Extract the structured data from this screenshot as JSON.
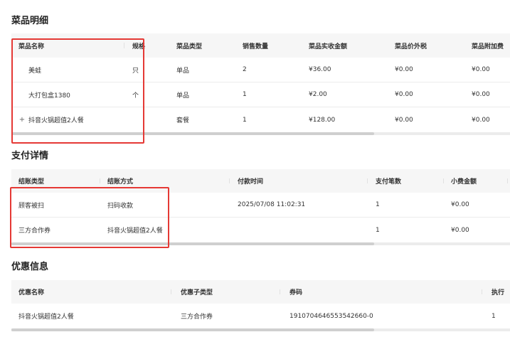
{
  "dish_section": {
    "title": "菜品明细",
    "columns": [
      "菜品名称",
      "规格",
      "菜品类型",
      "销售数量",
      "菜品实收金额",
      "菜品价外税",
      "菜品附加费"
    ],
    "rows": [
      {
        "name": "美蛙",
        "spec": "只",
        "type": "单品",
        "qty": "2",
        "amount": "¥36.00",
        "tax": "¥0.00",
        "surcharge": "¥0.00"
      },
      {
        "name": "大打包盒1380",
        "spec": "个",
        "type": "单品",
        "qty": "1",
        "amount": "¥2.00",
        "tax": "¥0.00",
        "surcharge": "¥0.00"
      },
      {
        "expand_icon": "+",
        "name": "抖音火锅超值2人餐",
        "spec": "",
        "type": "套餐",
        "qty": "1",
        "amount": "¥128.00",
        "tax": "¥0.00",
        "surcharge": "¥0.00"
      }
    ]
  },
  "payment_section": {
    "title": "支付详情",
    "columns": [
      "结账类型",
      "结账方式",
      "付款时间",
      "支付笔数",
      "小费金额"
    ],
    "rows": [
      {
        "settle_type": "顾客被扫",
        "method": "扫码收款",
        "time": "2025/07/08 11:02:31",
        "count": "1",
        "tip": "¥0.00"
      },
      {
        "settle_type": "三方合作券",
        "method": "抖音火锅超值2人餐",
        "time": "",
        "count": "1",
        "tip": "¥0.00"
      }
    ]
  },
  "discount_section": {
    "title": "优惠信息",
    "columns": [
      "优惠名称",
      "优惠子类型",
      "券码",
      "执行"
    ],
    "rows": [
      {
        "name": "抖音火锅超值2人餐",
        "subtype": "三方合作券",
        "code": "1910704646553542660-0",
        "exec": "1"
      }
    ]
  },
  "colors": {
    "highlight": "#e53935",
    "header_bg": "#f6f6f6"
  }
}
